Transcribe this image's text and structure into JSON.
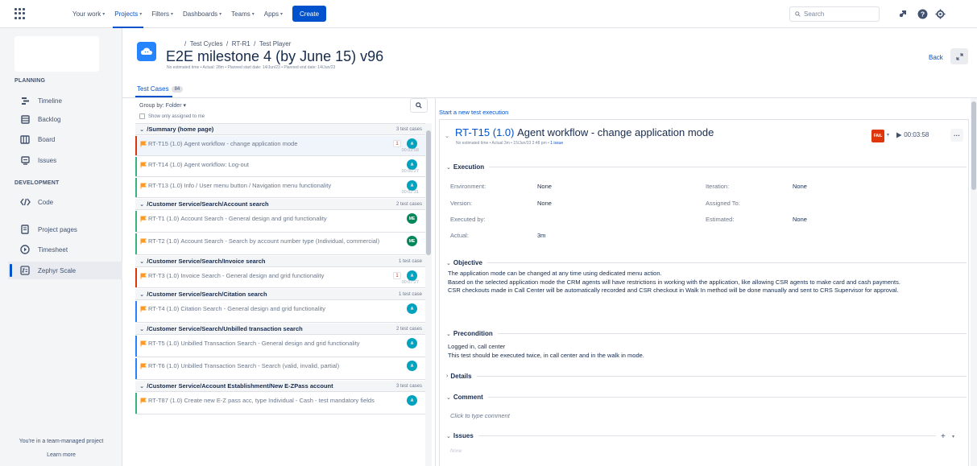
{
  "topnav": {
    "items": [
      {
        "label": "Your work",
        "active": false
      },
      {
        "label": "Projects",
        "active": true
      },
      {
        "label": "Filters",
        "active": false
      },
      {
        "label": "Dashboards",
        "active": false
      },
      {
        "label": "Teams",
        "active": false
      },
      {
        "label": "Apps",
        "active": false
      }
    ],
    "create_label": "Create",
    "search_placeholder": "Search"
  },
  "sidebar": {
    "planning_label": "PLANNING",
    "planning_items": [
      {
        "label": "Timeline",
        "icon": "timeline-icon"
      },
      {
        "label": "Backlog",
        "icon": "backlog-icon"
      },
      {
        "label": "Board",
        "icon": "board-icon"
      },
      {
        "label": "Issues",
        "icon": "issues-icon"
      }
    ],
    "development_label": "DEVELOPMENT",
    "development_items": [
      {
        "label": "Code",
        "icon": "code-icon"
      }
    ],
    "other_items": [
      {
        "label": "Project pages",
        "icon": "pages-icon"
      },
      {
        "label": "Timesheet",
        "icon": "timesheet-icon"
      },
      {
        "label": "Zephyr Scale",
        "icon": "zephyr-icon",
        "active": true
      }
    ],
    "footer_text": "You're in a team-managed project",
    "learn_more": "Learn more"
  },
  "header": {
    "breadcrumb_sep": "/",
    "breadcrumbs": [
      "Test Cycles",
      "RT-R1",
      "Test Player"
    ],
    "title": "E2E milestone 4 (by June 15) v96",
    "meta": "No estimated time • Actual: 28m • Planned start date: 14/Jun/23 • Planned end date: 14/Jun/23",
    "back_label": "Back"
  },
  "tab": {
    "label": "Test Cases",
    "count": "84"
  },
  "list_controls": {
    "group_by": "Group by: Folder",
    "show_only": "Show only assigned to me"
  },
  "folders": [
    {
      "name": "/Summary (home page)",
      "count": "3 test cases",
      "rows": [
        {
          "key": "RT-T15",
          "ver": "(1.0)",
          "name": "Agent workflow - change application mode",
          "status": "#de350b",
          "avatar": "A",
          "avatar_color": "#00a3bf",
          "time": "00:03:58",
          "bug": "1",
          "selected": true
        },
        {
          "key": "RT-T14",
          "ver": "(1.0)",
          "name": "Agent workflow: Log-out",
          "status": "#36b37e",
          "avatar": "A",
          "avatar_color": "#00a3bf",
          "time": "00:00:27"
        },
        {
          "key": "RT-T13",
          "ver": "(1.0)",
          "name": "Info / User menu button / Navigation menu functionality",
          "status": "#36b37e",
          "avatar": "A",
          "avatar_color": "#00a3bf",
          "time": "00:02:31"
        }
      ]
    },
    {
      "name": "/Customer Service/Search/Account search",
      "count": "2 test cases",
      "rows": [
        {
          "key": "RT-T1",
          "ver": "(1.0)",
          "name": "Account Search - General design and grid functionality",
          "status": "#36b37e",
          "avatar": "ME",
          "avatar_color": "#00875a"
        },
        {
          "key": "RT-T2",
          "ver": "(1.0)",
          "name": "Account Search - Search by account number type (Individual, commercial)",
          "status": "#36b37e",
          "avatar": "ME",
          "avatar_color": "#00875a"
        }
      ]
    },
    {
      "name": "/Customer Service/Search/Invoice search",
      "count": "1 test case",
      "rows": [
        {
          "key": "RT-T3",
          "ver": "(1.0)",
          "name": "Invoice Search - General design and grid functionality",
          "status": "#de350b",
          "avatar": "A",
          "avatar_color": "#00a3bf",
          "time": "00:07:27",
          "bug": "1"
        }
      ]
    },
    {
      "name": "/Customer Service/Search/Citation search",
      "count": "1 test case",
      "rows": [
        {
          "key": "RT-T4",
          "ver": "(1.0)",
          "name": "Citation Search - General design and grid functionality",
          "status": "#2684ff",
          "avatar": "A",
          "avatar_color": "#00a3bf"
        }
      ]
    },
    {
      "name": "/Customer Service/Search/Unbilled transaction search",
      "count": "2 test cases",
      "rows": [
        {
          "key": "RT-T5",
          "ver": "(1.0)",
          "name": "Unbilled Transaction Search - General design and grid functionality",
          "status": "#2684ff",
          "avatar": "A",
          "avatar_color": "#00a3bf"
        },
        {
          "key": "RT-T6",
          "ver": "(1.0)",
          "name": "Unbilled Transaction Search - Search (valid, invalid, partial)",
          "status": "#2684ff",
          "avatar": "A",
          "avatar_color": "#00a3bf"
        }
      ]
    },
    {
      "name": "/Customer Service/Account Establishment/New E-ZPass account",
      "count": "3 test cases",
      "rows": [
        {
          "key": "RT-T87",
          "ver": "(1.0)",
          "name": "Create new E-Z pass acc, type Individual - Cash - test mandatory fields",
          "status": "#36b37e",
          "avatar": "A",
          "avatar_color": "#00a3bf"
        }
      ]
    }
  ],
  "detail": {
    "start_new": "Start a new test execution",
    "key": "RT-T15",
    "ver": "(1.0)",
    "title": "Agent workflow - change application mode",
    "meta_prefix": "No estimated time • Actual 3m • 15/Jun/23 2:48 pm •",
    "meta_link": "1 issue",
    "status": "FAIL",
    "timer": "00:03:58",
    "more": "···",
    "execution_label": "Execution",
    "fields": {
      "environment_label": "Environment:",
      "environment": "None",
      "version_label": "Version:",
      "version": "None",
      "executed_by_label": "Executed by:",
      "executed_by": "",
      "actual_label": "Actual:",
      "actual": "3m",
      "iteration_label": "Iteration:",
      "iteration": "None",
      "assigned_label": "Assigned To:",
      "assigned": "",
      "estimated_label": "Estimated:",
      "estimated": "None"
    },
    "objective_label": "Objective",
    "objective_lines": [
      "The application mode can be changed at any time using dedicated menu action.",
      "Based on the selected application mode the CRM agents will have restrictions in working with the application, like allowing CSR agents to make card and cash payments.",
      "CSR checkouts made in Call Center will be automatically recorded and CSR checkout in Walk In method will be done manually and sent to CRS Supervisor for approval."
    ],
    "precondition_label": "Precondition",
    "precondition_lines": [
      "Logged in, call center",
      "This test should be executed twice, in call center and in the walk in mode."
    ],
    "details_label": "Details",
    "comment_label": "Comment",
    "comment_placeholder": "Click to type comment",
    "issues_label": "Issues",
    "issues_none": "None"
  }
}
